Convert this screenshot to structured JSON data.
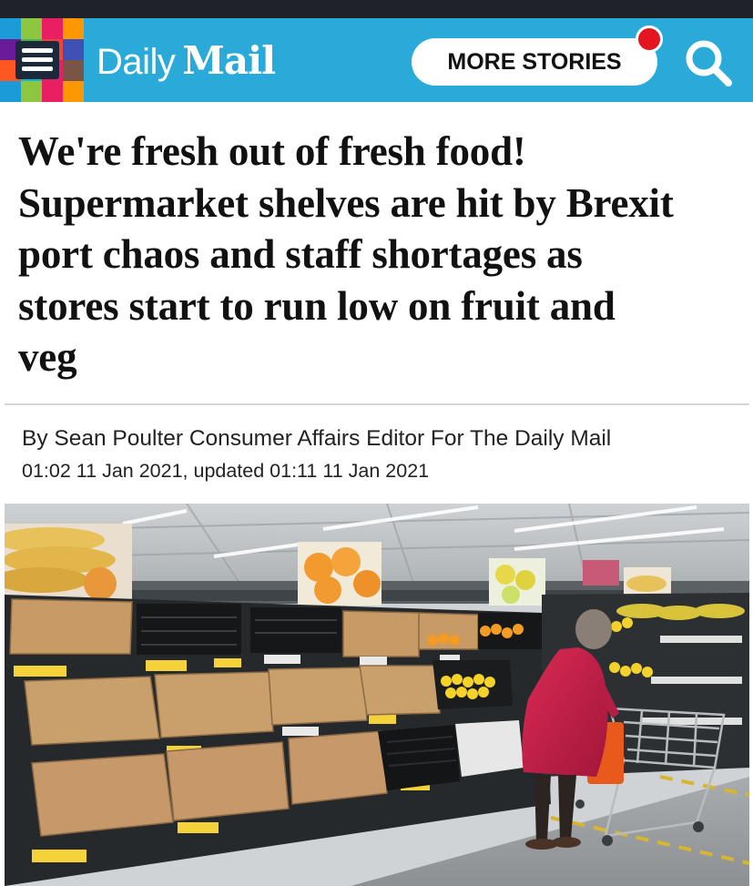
{
  "header": {
    "logo_daily": "Daily",
    "logo_mail": "Mail",
    "more_stories_label": "MORE STORIES",
    "brand_color": "#2aaad8",
    "notification_color": "#e4151f",
    "menu_tile_colors": [
      "#1b9bd7",
      "#8dc63f",
      "#e91e63",
      "#ff9800",
      "#6a1b9a",
      "#4caf50",
      "#f44336",
      "#3f51b5",
      "#ff5722",
      "#00bcd4",
      "#e91e63",
      "#795548"
    ]
  },
  "icons": {
    "menu": "hamburger-menu-icon",
    "search": "search-icon",
    "notification": "notification-dot-icon"
  },
  "article": {
    "headline_lines": [
      "We're fresh out of fresh food!",
      "Supermarket shelves are hit by Brexit",
      "port chaos and staff shortages as",
      "stores start to run low on fruit and",
      "veg"
    ],
    "byline": "By Sean Poulter Consumer Affairs Editor For The Daily Mail",
    "timestamp": "01:02 11 Jan 2021, updated 01:11 11 Jan 2021"
  },
  "photo": {
    "subject": "Supermarket produce shelves with empty cardboard trays and a shopper with a trolley"
  }
}
